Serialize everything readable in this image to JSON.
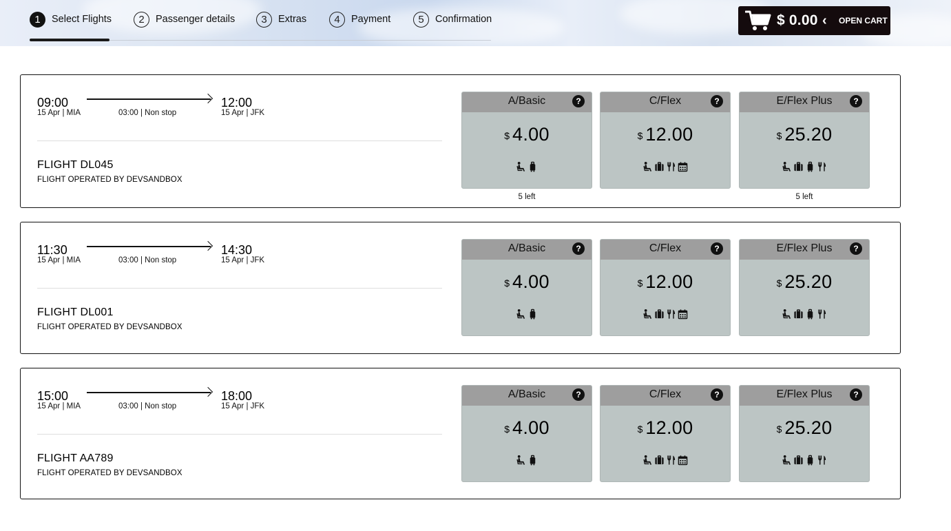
{
  "steps": [
    {
      "num": "1",
      "label": "Select Flights",
      "active": true
    },
    {
      "num": "2",
      "label": "Passenger details"
    },
    {
      "num": "3",
      "label": "Extras"
    },
    {
      "num": "4",
      "label": "Payment"
    },
    {
      "num": "5",
      "label": "Confirmation"
    }
  ],
  "cart": {
    "total": "$ 0.00",
    "chevron": "‹",
    "open_label": "OPEN CART",
    "icon": "shopping-cart-icon"
  },
  "flights": [
    {
      "depart_time": "09:00",
      "depart_info": "15 Apr | MIA",
      "duration": "03:00 | Non stop",
      "arrive_time": "12:00",
      "arrive_info": "15 Apr | JFK",
      "flight_no": "FLIGHT DL045",
      "operated_by": "FLIGHT OPERATED BY DEVSANDBOX",
      "fares": [
        {
          "name": "A/Basic",
          "currency": "$",
          "amount": "4.00",
          "amenities": [
            "seat-icon",
            "luggage-icon"
          ],
          "left": "5 left"
        },
        {
          "name": "C/Flex",
          "currency": "$",
          "amount": "12.00",
          "amenities": [
            "seat-icon",
            "suitcase-icon",
            "meal-icon",
            "calendar-icon"
          ],
          "left": ""
        },
        {
          "name": "E/Flex Plus",
          "currency": "$",
          "amount": "25.20",
          "amenities": [
            "seat-icon",
            "suitcase-icon",
            "luggage-icon",
            "meal-icon"
          ],
          "left": "5 left"
        }
      ]
    },
    {
      "depart_time": "11:30",
      "depart_info": "15 Apr | MIA",
      "duration": "03:00 | Non stop",
      "arrive_time": "14:30",
      "arrive_info": "15 Apr | JFK",
      "flight_no": "FLIGHT DL001",
      "operated_by": "FLIGHT OPERATED BY DEVSANDBOX",
      "fares": [
        {
          "name": "A/Basic",
          "currency": "$",
          "amount": "4.00",
          "amenities": [
            "seat-icon",
            "luggage-icon"
          ],
          "left": ""
        },
        {
          "name": "C/Flex",
          "currency": "$",
          "amount": "12.00",
          "amenities": [
            "seat-icon",
            "suitcase-icon",
            "meal-icon",
            "calendar-icon"
          ],
          "left": ""
        },
        {
          "name": "E/Flex Plus",
          "currency": "$",
          "amount": "25.20",
          "amenities": [
            "seat-icon",
            "suitcase-icon",
            "luggage-icon",
            "meal-icon"
          ],
          "left": ""
        }
      ]
    },
    {
      "depart_time": "15:00",
      "depart_info": "15 Apr | MIA",
      "duration": "03:00 | Non stop",
      "arrive_time": "18:00",
      "arrive_info": "15 Apr | JFK",
      "flight_no": "FLIGHT AA789",
      "operated_by": "FLIGHT OPERATED BY DEVSANDBOX",
      "fares": [
        {
          "name": "A/Basic",
          "currency": "$",
          "amount": "4.00",
          "amenities": [
            "seat-icon",
            "luggage-icon"
          ],
          "left": ""
        },
        {
          "name": "C/Flex",
          "currency": "$",
          "amount": "12.00",
          "amenities": [
            "seat-icon",
            "suitcase-icon",
            "meal-icon",
            "calendar-icon"
          ],
          "left": ""
        },
        {
          "name": "E/Flex Plus",
          "currency": "$",
          "amount": "25.20",
          "amenities": [
            "seat-icon",
            "suitcase-icon",
            "luggage-icon",
            "meal-icon"
          ],
          "left": ""
        }
      ]
    }
  ],
  "colors": {
    "fare_body": "#bcc5c4",
    "fare_header": "#9e9e9e",
    "cart_bg": "#140b0d"
  }
}
